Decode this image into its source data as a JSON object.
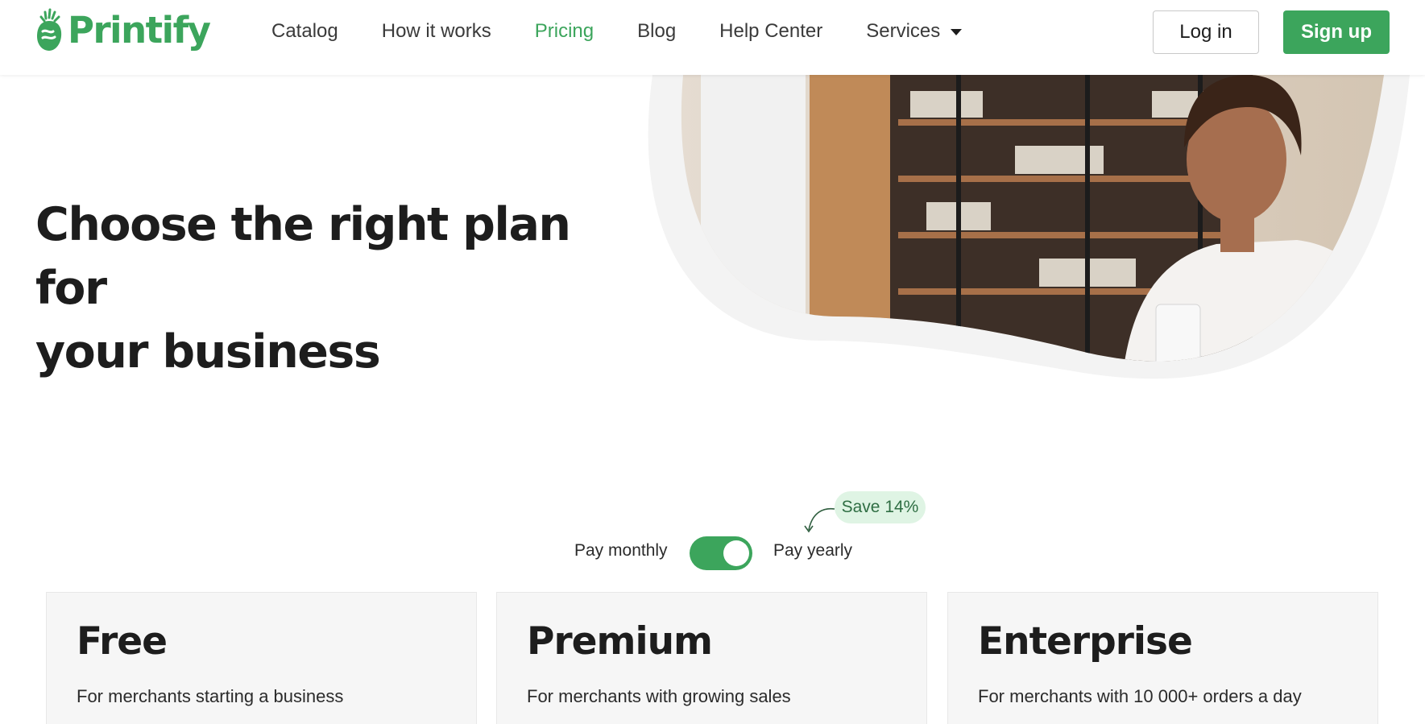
{
  "header": {
    "brand": "Printify",
    "nav": [
      {
        "label": "Catalog",
        "active": false
      },
      {
        "label": "How it works",
        "active": false
      },
      {
        "label": "Pricing",
        "active": true
      },
      {
        "label": "Blog",
        "active": false
      },
      {
        "label": "Help Center",
        "active": false
      },
      {
        "label": "Services",
        "active": false,
        "dropdown": true
      }
    ],
    "login_label": "Log in",
    "signup_label": "Sign up"
  },
  "hero": {
    "title_line1": "Choose the right plan for",
    "title_line2": "your business",
    "image_alt": "woman-with-coffee-and-phone-photo"
  },
  "billing": {
    "monthly_label": "Pay monthly",
    "yearly_label": "Pay yearly",
    "save_badge": "Save 14%",
    "yearly_selected": true
  },
  "plans": [
    {
      "name": "Free",
      "description": "For merchants starting a business"
    },
    {
      "name": "Premium",
      "description": "For merchants with growing sales"
    },
    {
      "name": "Enterprise",
      "description": "For merchants with 10 000+ orders a day"
    }
  ],
  "colors": {
    "brand_green": "#3ca55c",
    "badge_bg": "#dff4e4",
    "card_bg": "#f6f6f6",
    "text": "#1d1d1d"
  }
}
